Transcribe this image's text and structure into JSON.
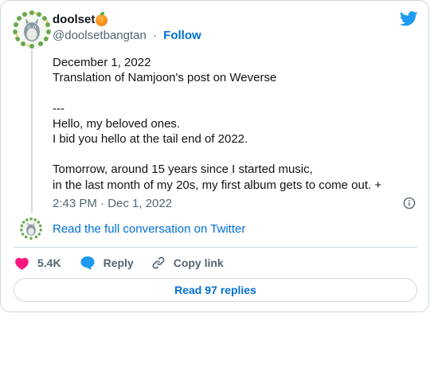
{
  "author": {
    "display_name": "doolset",
    "name_emoji_icon": "orange-tangerine-icon",
    "handle": "@doolsetbangtan",
    "separator": "·",
    "follow_label": "Follow",
    "avatar_icon": "totoro-wreath-avatar"
  },
  "tweet": {
    "lines": [
      "December 1, 2022",
      "Translation of Namjoon's post on Weverse",
      "",
      "---",
      "Hello, my beloved ones.",
      "I bid you hello at the tail end of 2022.",
      "",
      "Tomorrow, around 15 years since I started music,",
      "in the last month of my 20s, my first album gets to come out. +"
    ],
    "timestamp": "2:43 PM · Dec 1, 2022"
  },
  "conversation": {
    "read_full_label": "Read the full conversation on Twitter"
  },
  "actions": {
    "like_count": "5.4K",
    "reply_label": "Reply",
    "copy_link_label": "Copy link"
  },
  "replies": {
    "read_replies_label": "Read 97 replies"
  },
  "colors": {
    "brand_blue": "#1d9bf0",
    "link_blue": "#006fd6",
    "like_pink": "#f91880",
    "muted_text": "#536471",
    "border": "#cfd9de"
  }
}
